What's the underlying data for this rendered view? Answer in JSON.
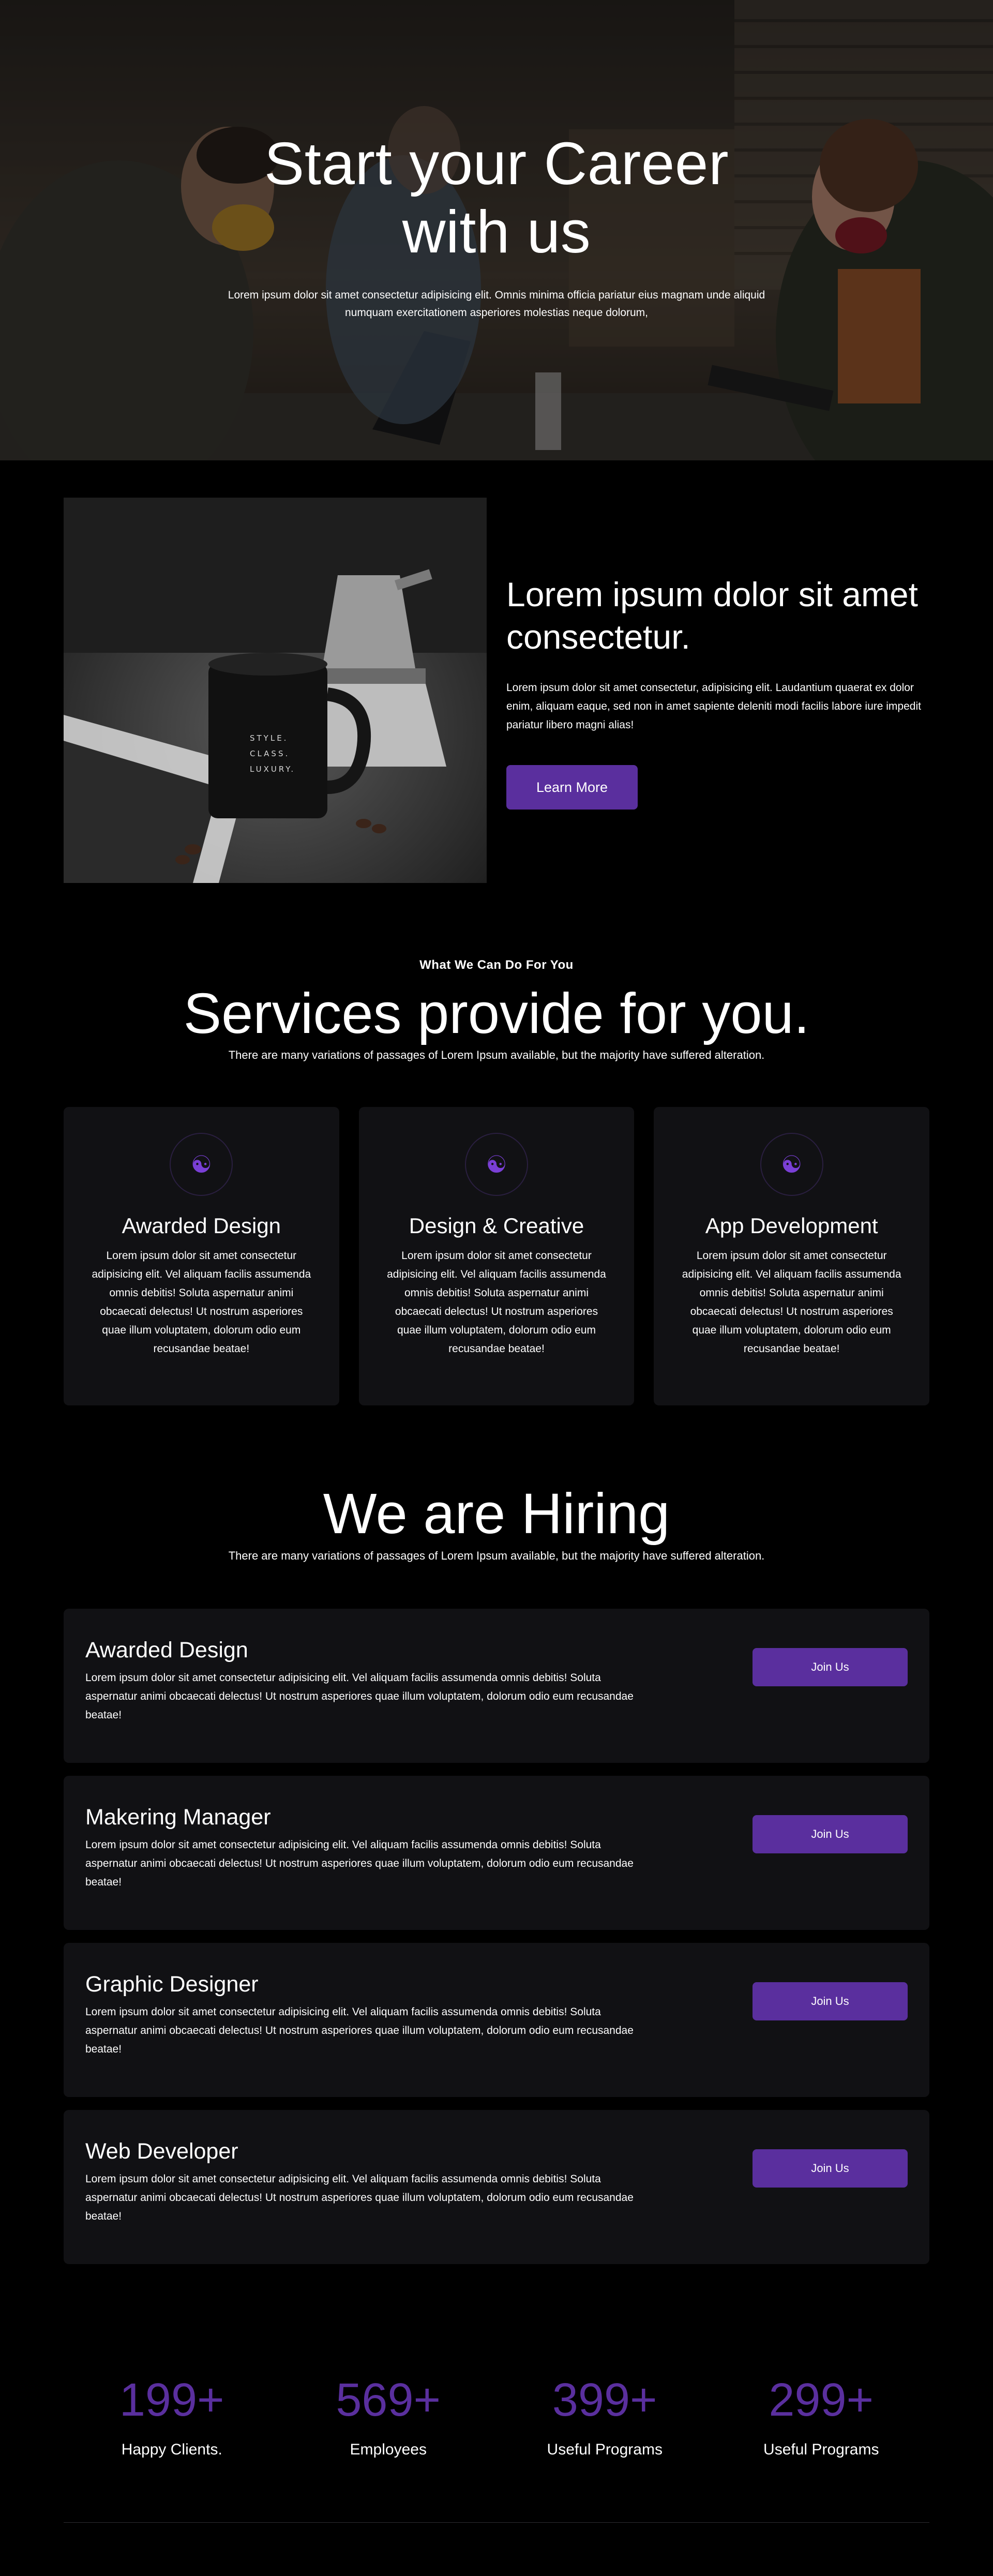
{
  "hero": {
    "title": "Start your Career with us",
    "text": "Lorem ipsum dolor sit amet consectetur adipisicing elit. Omnis minima officia pariatur eius magnam unde aliquid numquam exercitationem asperiores molestias neque dolorum,"
  },
  "about": {
    "mug_text": "STYLE. CLASS. LUXURY.",
    "title": "Lorem ipsum dolor sit amet consectetur.",
    "text": "Lorem ipsum dolor sit amet consectetur, adipisicing elit. Laudantium quaerat ex dolor enim, aliquam eaque, sed non in amet sapiente deleniti modi facilis labore iure impedit pariatur libero magni alias!",
    "button": "Learn More"
  },
  "services": {
    "eyebrow": "What We Can Do For You",
    "title": "Services provide for you.",
    "subtitle": "There are many variations of passages of Lorem Ipsum available, but the majority have suffered alteration.",
    "cards": [
      {
        "icon": "yin-yang-icon",
        "title": "Awarded Design",
        "text": "Lorem ipsum dolor sit amet consectetur adipisicing elit. Vel aliquam facilis assumenda omnis debitis! Soluta aspernatur animi obcaecati delectus! Ut nostrum asperiores quae illum voluptatem, dolorum odio eum recusandae beatae!"
      },
      {
        "icon": "yin-yang-icon",
        "title": "Design & Creative",
        "text": "Lorem ipsum dolor sit amet consectetur adipisicing elit. Vel aliquam facilis assumenda omnis debitis! Soluta aspernatur animi obcaecati delectus! Ut nostrum asperiores quae illum voluptatem, dolorum odio eum recusandae beatae!"
      },
      {
        "icon": "yin-yang-icon",
        "title": "App Development",
        "text": "Lorem ipsum dolor sit amet consectetur adipisicing elit. Vel aliquam facilis assumenda omnis debitis! Soluta aspernatur animi obcaecati delectus! Ut nostrum asperiores quae illum voluptatem, dolorum odio eum recusandae beatae!"
      }
    ]
  },
  "hiring": {
    "title": "We are Hiring",
    "subtitle": "There are many variations of passages of Lorem Ipsum available, but the majority have suffered alteration.",
    "jobs": [
      {
        "title": "Awarded Design",
        "text": "Lorem ipsum dolor sit amet consectetur adipisicing elit. Vel aliquam facilis assumenda omnis debitis! Soluta aspernatur animi obcaecati delectus! Ut nostrum asperiores quae illum voluptatem, dolorum odio eum recusandae beatae!",
        "button": "Join Us"
      },
      {
        "title": "Makering Manager",
        "text": "Lorem ipsum dolor sit amet consectetur adipisicing elit. Vel aliquam facilis assumenda omnis debitis! Soluta aspernatur animi obcaecati delectus! Ut nostrum asperiores quae illum voluptatem, dolorum odio eum recusandae beatae!",
        "button": "Join Us"
      },
      {
        "title": "Graphic Designer",
        "text": "Lorem ipsum dolor sit amet consectetur adipisicing elit. Vel aliquam facilis assumenda omnis debitis! Soluta aspernatur animi obcaecati delectus! Ut nostrum asperiores quae illum voluptatem, dolorum odio eum recusandae beatae!",
        "button": "Join Us"
      },
      {
        "title": "Web Developer",
        "text": "Lorem ipsum dolor sit amet consectetur adipisicing elit. Vel aliquam facilis assumenda omnis debitis! Soluta aspernatur animi obcaecati delectus! Ut nostrum asperiores quae illum voluptatem, dolorum odio eum recusandae beatae!",
        "button": "Join Us"
      }
    ]
  },
  "stats": [
    {
      "value": "199+",
      "label": "Happy Clients."
    },
    {
      "value": "569+",
      "label": "Employees"
    },
    {
      "value": "399+",
      "label": "Useful Programs"
    },
    {
      "value": "299+",
      "label": "Useful Programs"
    }
  ],
  "colors": {
    "accent": "#5a2f9e",
    "background": "#000000",
    "card": "#111114"
  }
}
